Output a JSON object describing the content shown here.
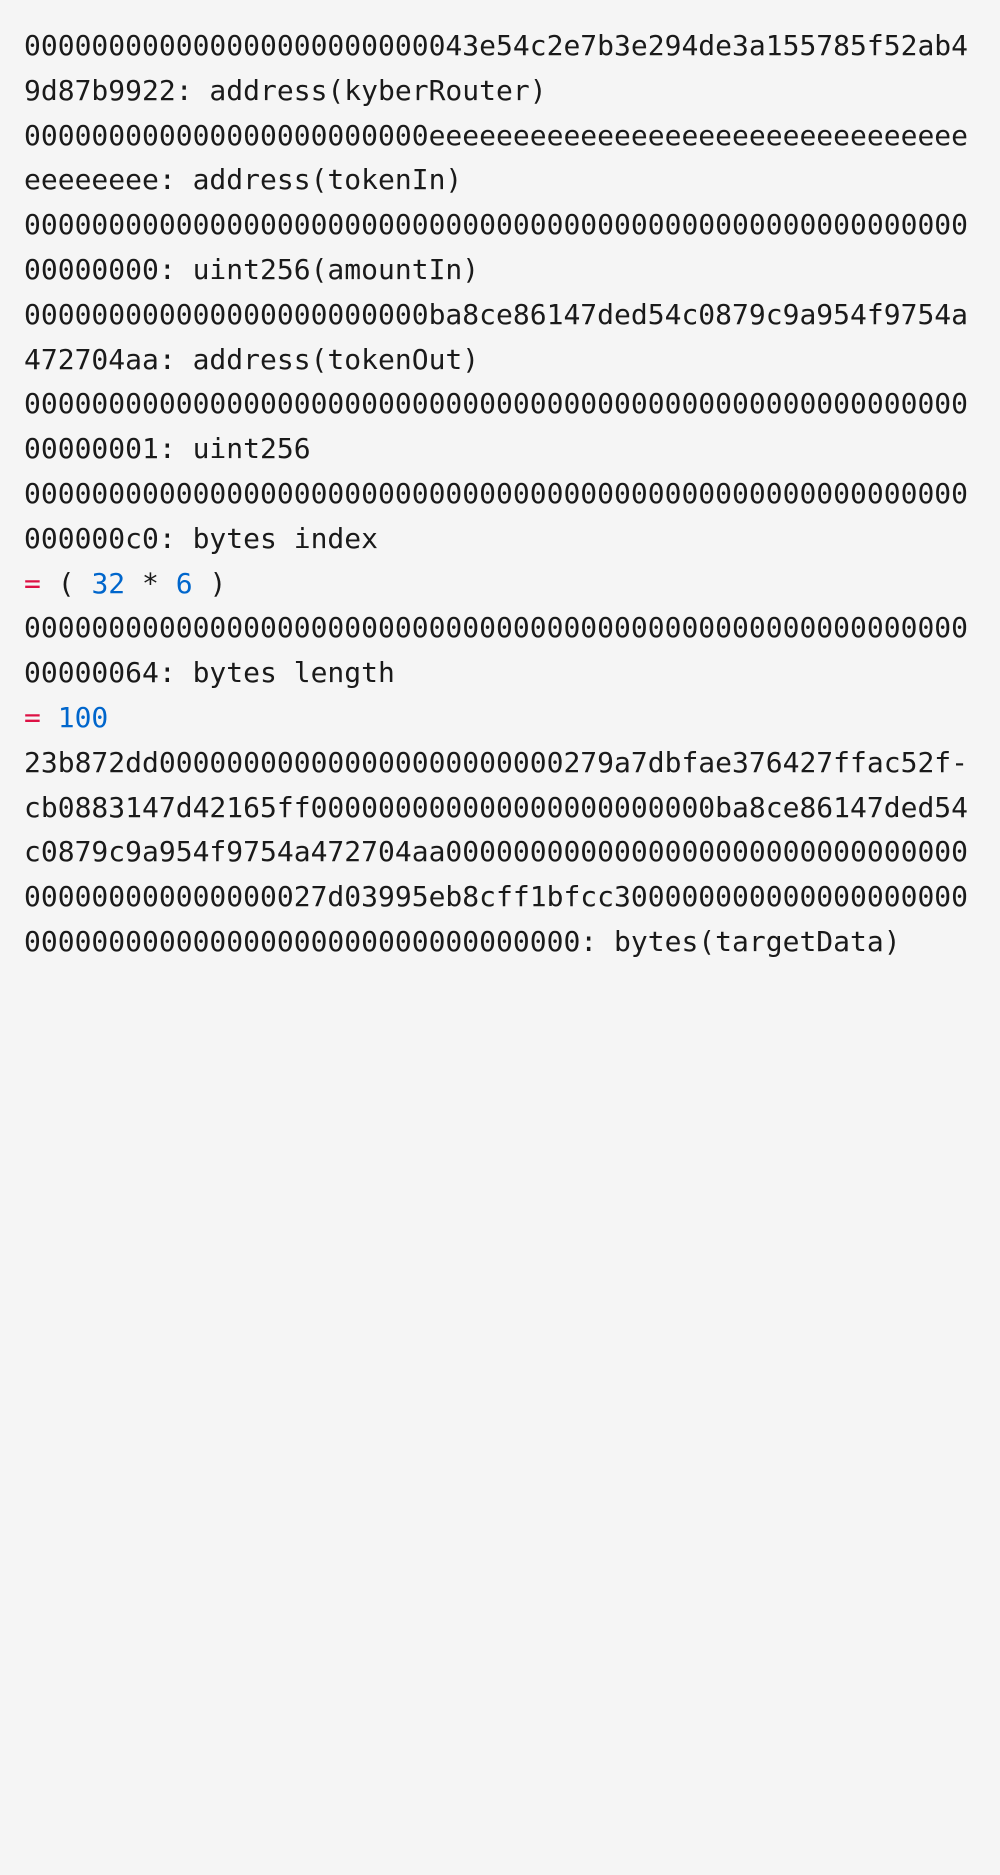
{
  "lines": [
    {
      "raw": "000000000000000000000000043e54c2e7b3e294de3a155785f52ab49d87b9922: address(kyberRouter)"
    },
    {
      "raw": "000000000000000000000000eeeeeeeeeeeeeeeeeeeeeeeeeeeeeeeeeeeeeeee: address(tokenIn)"
    },
    {
      "raw": "0000000000000000000000000000000000000000000000000000000000000000: uint256(amountIn)"
    },
    {
      "raw": "000000000000000000000000ba8ce86147ded54c0879c9a954f9754a472704aa: address(tokenOut)"
    },
    {
      "raw": "0000000000000000000000000000000000000000000000000000000000000001: uint256"
    },
    {
      "raw": "00000000000000000000000000000000000000000000000000000000000000c0: bytes index"
    },
    {
      "expr": {
        "eq": "=",
        "open": " ( ",
        "n1": "32",
        "op": " * ",
        "n2": "6",
        "close": " )"
      }
    },
    {
      "raw": "0000000000000000000000000000000000000000000000000000000000000064: bytes length"
    },
    {
      "expr": {
        "eq": "=",
        "space": " ",
        "n1": "100"
      }
    },
    {
      "raw": "23b872dd000000000000000000000000279a7dbfae376427ffac52f-"
    },
    {
      "raw": "cb0883147d42165ff000000000000000000000000ba8ce86147ded54c0879c9a954f9754a472704aa0000000000000000000000000000000000000000000000027d03995eb8cff1bfcc300000000000000000000000000000000000000000000000000000: bytes(targetData)"
    }
  ]
}
